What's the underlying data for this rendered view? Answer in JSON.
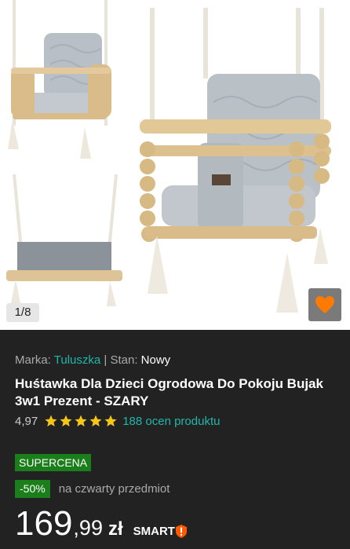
{
  "gallery": {
    "counter": "1/8",
    "favorite_icon": "heart-icon",
    "favorite_color": "#ff7a00"
  },
  "product": {
    "brand_label": "Marka:",
    "brand": "Tuluszka",
    "separator": "|",
    "condition_label": "Stan:",
    "condition": "Nowy",
    "title": "Huśtawka Dla Dzieci Ogrodowa Do Pokoju Bujak 3w1 Prezent - SZARY",
    "rating": "4,97",
    "stars": 5,
    "reviews": "188 ocen produktu"
  },
  "pricing": {
    "supercena": "SUPERCENA",
    "discount": "-50%",
    "discount_note": "na czwarty przedmiot",
    "price_integer": "169",
    "price_decimal": ",99",
    "currency": "zł",
    "smart": "SMART"
  },
  "colors": {
    "accent_teal": "#1fb8a8",
    "promo_green": "#1a7f1a",
    "star": "#f5c518",
    "background": "#222222"
  }
}
